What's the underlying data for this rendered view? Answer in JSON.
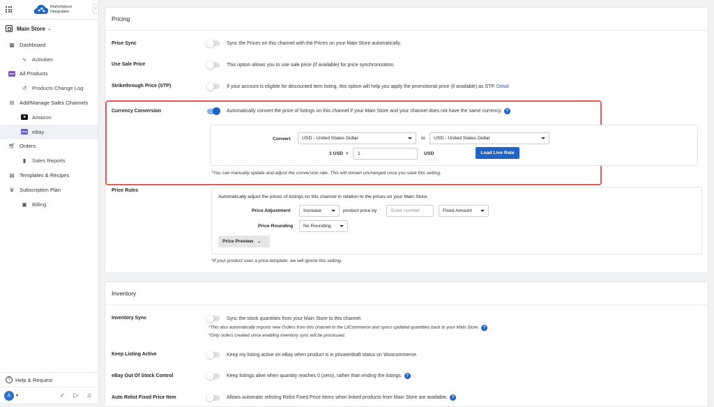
{
  "app": {
    "logo_line1": "Marketplace",
    "logo_line2": "Integration",
    "collapse": "‹"
  },
  "store": {
    "name": "Main Store"
  },
  "sidebar": {
    "items": [
      {
        "label": "Dashboard"
      },
      {
        "label": "Activities"
      },
      {
        "label": "All Products"
      },
      {
        "label": "Products Change Log"
      },
      {
        "label": "Add/Manage Sales Channels"
      },
      {
        "label": "Amazon"
      },
      {
        "label": "eBay"
      },
      {
        "label": "Orders"
      },
      {
        "label": "Sales Reports"
      },
      {
        "label": "Templates & Recipes"
      },
      {
        "label": "Subscription Plan"
      },
      {
        "label": "Billing"
      }
    ],
    "help": "Help & Request",
    "user_initials": "JL"
  },
  "pricing": {
    "title": "Pricing",
    "price_sync": {
      "label": "Price Sync",
      "on": false,
      "desc": "Sync the Prices on this channel with the Prices on your Main Store automatically."
    },
    "use_sale_price": {
      "label": "Use Sale Price",
      "on": false,
      "desc": "This option allows you to use sale price (if available) for price synchronization."
    },
    "strikethrough": {
      "label": "Strikethrough Price (STP)",
      "on": false,
      "desc": "If your account is eligible for discounted item listing, this option will help you apply the promotional price (if available) as STP.",
      "link": "Detail"
    },
    "currency": {
      "label": "Currency Conversion",
      "on": true,
      "desc": "Automatically convert the price of listings on this channel if your Main Store and your channel does not have the same currency.",
      "convert_label": "Convert",
      "from": "USD - United States Dollar",
      "to_label": "to",
      "to": "USD - United States Dollar",
      "rate_label": "1 USD  =",
      "rate_value": "1",
      "rate_unit": "USD",
      "load_button": "Load Live Rate",
      "note": "*You can manually update and adjust the conversion rate. This will remain unchanged once you save this setting."
    },
    "price_rules": {
      "label": "Price Rules",
      "desc": "Automatically adjust the prices of listings on this channel in relation to the prices on your Main Store.",
      "adjustment_label": "Price Adjustment",
      "adjustment_value": "Increase",
      "by_label": "product price by",
      "number_placeholder": "Enter number",
      "mode_value": "Fixed Amount",
      "rounding_label": "Price Rounding",
      "rounding_value": "No Rounding",
      "preview_button": "Price Preview",
      "note": "*If your product uses a price template, we will ignore this setting."
    }
  },
  "inventory": {
    "title": "Inventory",
    "sync": {
      "label": "Inventory Sync",
      "on": false,
      "desc": "Sync the stock quantities from your Main Store to this channel.",
      "note1": "*This also automatically imports new Orders from this channel to the LitCommerce and syncs updated quantities back to your Main Store.",
      "note2": "*Only orders created since enabling inventory sync will be processed."
    },
    "keep_active": {
      "label": "Keep Listing Active",
      "on": false,
      "desc": "Keep my listing active on eBay when product is in private/draft status on Woocommerce."
    },
    "oos": {
      "label": "eBay Out Of Stock Control",
      "on": false,
      "desc": "Keep listings alive when quantity reaches 0 (zero), rather than ending the listings."
    },
    "relist": {
      "label": "Auto Relist Fixed Price Item",
      "on": false,
      "desc": "Allows automatic relisting Relist Fixed Price Items when linked products from Main Store are available."
    }
  },
  "colors": {
    "accent": "#1f63c7",
    "highlight": "#e05a5a"
  }
}
